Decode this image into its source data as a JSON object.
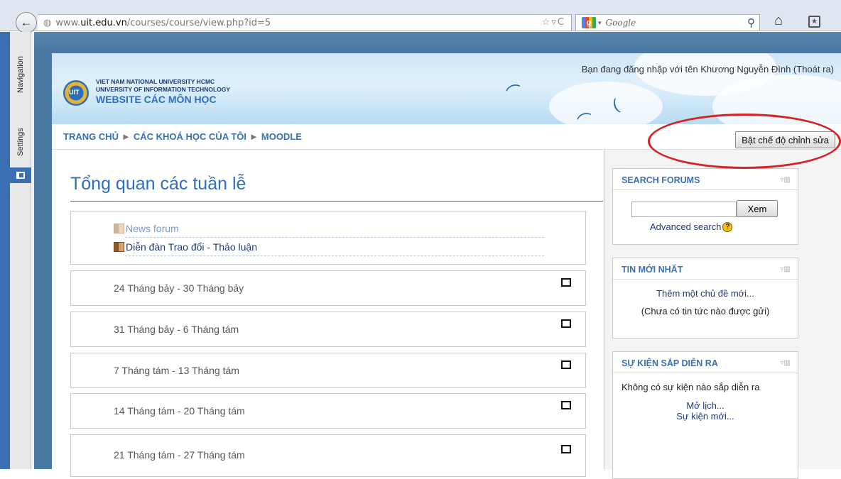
{
  "browser": {
    "url_prefix": "www.",
    "url_domain": "uit.edu.vn",
    "url_path": "/courses/course/view.php?id=5",
    "search_placeholder": "Google"
  },
  "sidebar": {
    "navigation_label": "Navigation",
    "settings_label": "Settings"
  },
  "header": {
    "university_line1": "VIET NAM NATIONAL UNIVERSITY HCMC",
    "university_line2": "UNIVERSITY OF INFORMATION TECHNOLOGY",
    "site_title": "WEBSITE CÁC MÔN HỌC",
    "login_text": "Bạn đang đăng nhập với tên Khương Nguyễn Đình (Thoát ra)",
    "logo_text": "UIT"
  },
  "breadcrumb": {
    "items": [
      "TRANG CHỦ",
      "CÁC KHOÁ HỌC CỦA TÔI",
      "MOODLE"
    ],
    "separator": "►"
  },
  "edit_button_label": "Bật chế độ chỉnh sửa",
  "main": {
    "title": "Tổng quan các tuần lễ",
    "activities": [
      {
        "label": "News forum"
      },
      {
        "label": "Diễn đàn Trao đổi - Thảo luận"
      }
    ],
    "weeks": [
      {
        "label": "24 Tháng bảy - 30 Tháng bảy"
      },
      {
        "label": "31 Tháng bảy - 6 Tháng tám"
      },
      {
        "label": "7 Tháng tám - 13 Tháng tám"
      },
      {
        "label": "14 Tháng tám - 20 Tháng tám"
      },
      {
        "label": "21 Tháng tám - 27 Tháng tám"
      }
    ]
  },
  "blocks": {
    "search_forums": {
      "title": "SEARCH FORUMS",
      "button": "Xem",
      "advanced": "Advanced search"
    },
    "news": {
      "title": "TIN MỚI NHẤT",
      "add_topic": "Thêm một chủ đề mới...",
      "no_news": "(Chưa có tin tức nào được gửi)"
    },
    "events": {
      "title": "SỰ KIỆN SẮP DIỄN RA",
      "no_events": "Không có sự kiện nào sắp diễn ra",
      "open_calendar": "Mở lịch...",
      "new_event": "Sự kiện mới..."
    }
  }
}
